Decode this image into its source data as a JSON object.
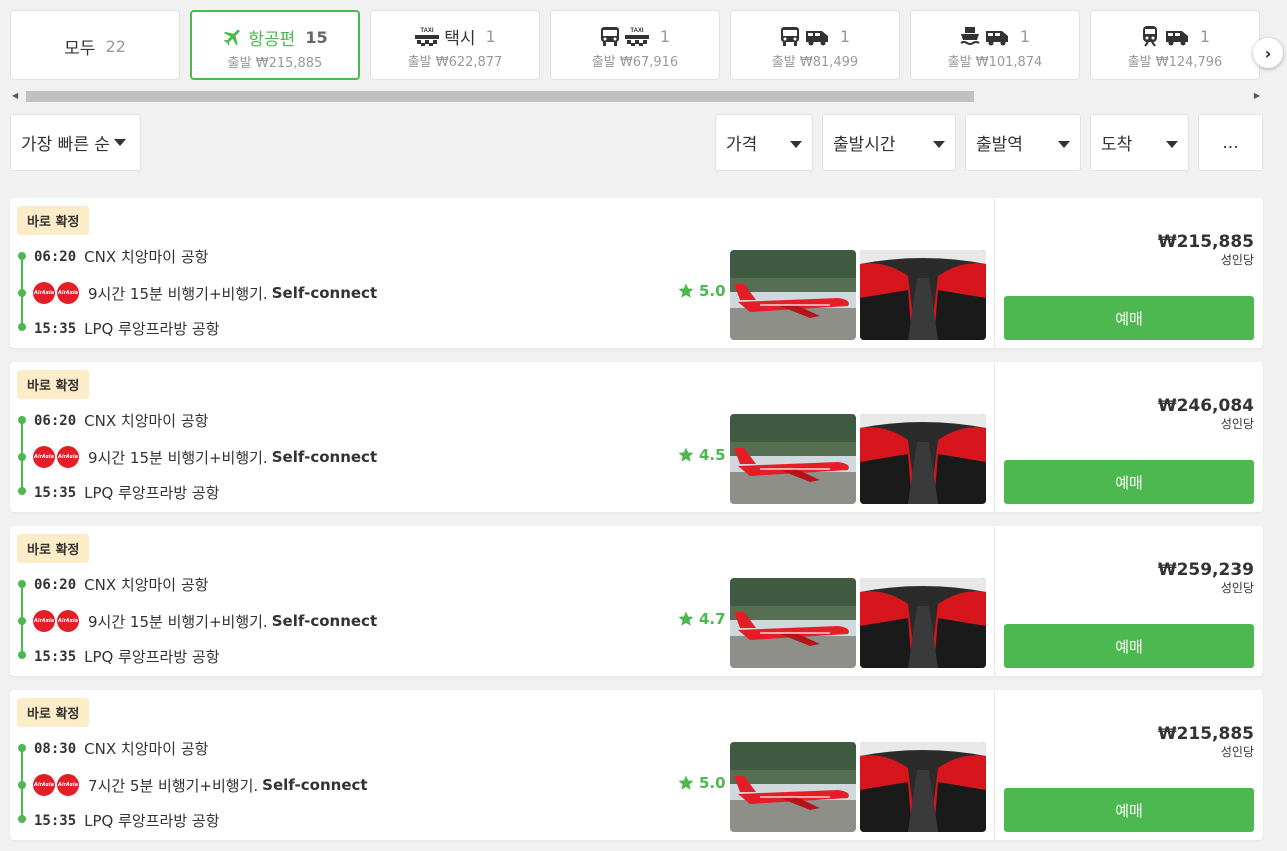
{
  "tabs": [
    {
      "label": "모두",
      "count": "22",
      "price": ""
    },
    {
      "label": "항공편",
      "count": "15",
      "price": "출발 ₩215,885"
    },
    {
      "label": "택시",
      "count": "1",
      "price": "출발 ₩622,877"
    },
    {
      "label": "",
      "count": "1",
      "price": "출발 ₩67,916"
    },
    {
      "label": "",
      "count": "1",
      "price": "출발 ₩81,499"
    },
    {
      "label": "",
      "count": "1",
      "price": "출발 ₩101,874"
    },
    {
      "label": "",
      "count": "1",
      "price": "출발 ₩124,796"
    }
  ],
  "taxi_sign": "TAXI",
  "filters": {
    "sort": "가장 빠른 순",
    "price": "가격",
    "depart_time": "출발시간",
    "depart_station": "출발역",
    "arrival": "도착",
    "more": "..."
  },
  "airline_logo_text": "AirAsia",
  "results": [
    {
      "badge": "바로 확정",
      "dep_time": "06:20",
      "dep_place": "CNX 치앙마이 공항",
      "duration": "9시간 15분 비행기+비행기.",
      "connect": "Self-connect",
      "arr_time": "15:35",
      "arr_place": "LPQ 루앙프라방 공항",
      "rating": "5.0",
      "price": "₩215,885",
      "per": "성인당",
      "book": "예매"
    },
    {
      "badge": "바로 확정",
      "dep_time": "06:20",
      "dep_place": "CNX 치앙마이 공항",
      "duration": "9시간 15분 비행기+비행기.",
      "connect": "Self-connect",
      "arr_time": "15:35",
      "arr_place": "LPQ 루앙프라방 공항",
      "rating": "4.5",
      "price": "₩246,084",
      "per": "성인당",
      "book": "예매"
    },
    {
      "badge": "바로 확정",
      "dep_time": "06:20",
      "dep_place": "CNX 치앙마이 공항",
      "duration": "9시간 15분 비행기+비행기.",
      "connect": "Self-connect",
      "arr_time": "15:35",
      "arr_place": "LPQ 루앙프라방 공항",
      "rating": "4.7",
      "price": "₩259,239",
      "per": "성인당",
      "book": "예매"
    },
    {
      "badge": "바로 확정",
      "dep_time": "08:30",
      "dep_place": "CNX 치앙마이 공항",
      "duration": "7시간 5분 비행기+비행기.",
      "connect": "Self-connect",
      "arr_time": "15:35",
      "arr_place": "LPQ 루앙프라방 공항",
      "rating": "5.0",
      "price": "₩215,885",
      "per": "성인당",
      "book": "예매"
    }
  ],
  "colors": {
    "accent": "#4cb84f",
    "badge_bg": "#fdecc8",
    "airline_red": "#e41e26"
  }
}
